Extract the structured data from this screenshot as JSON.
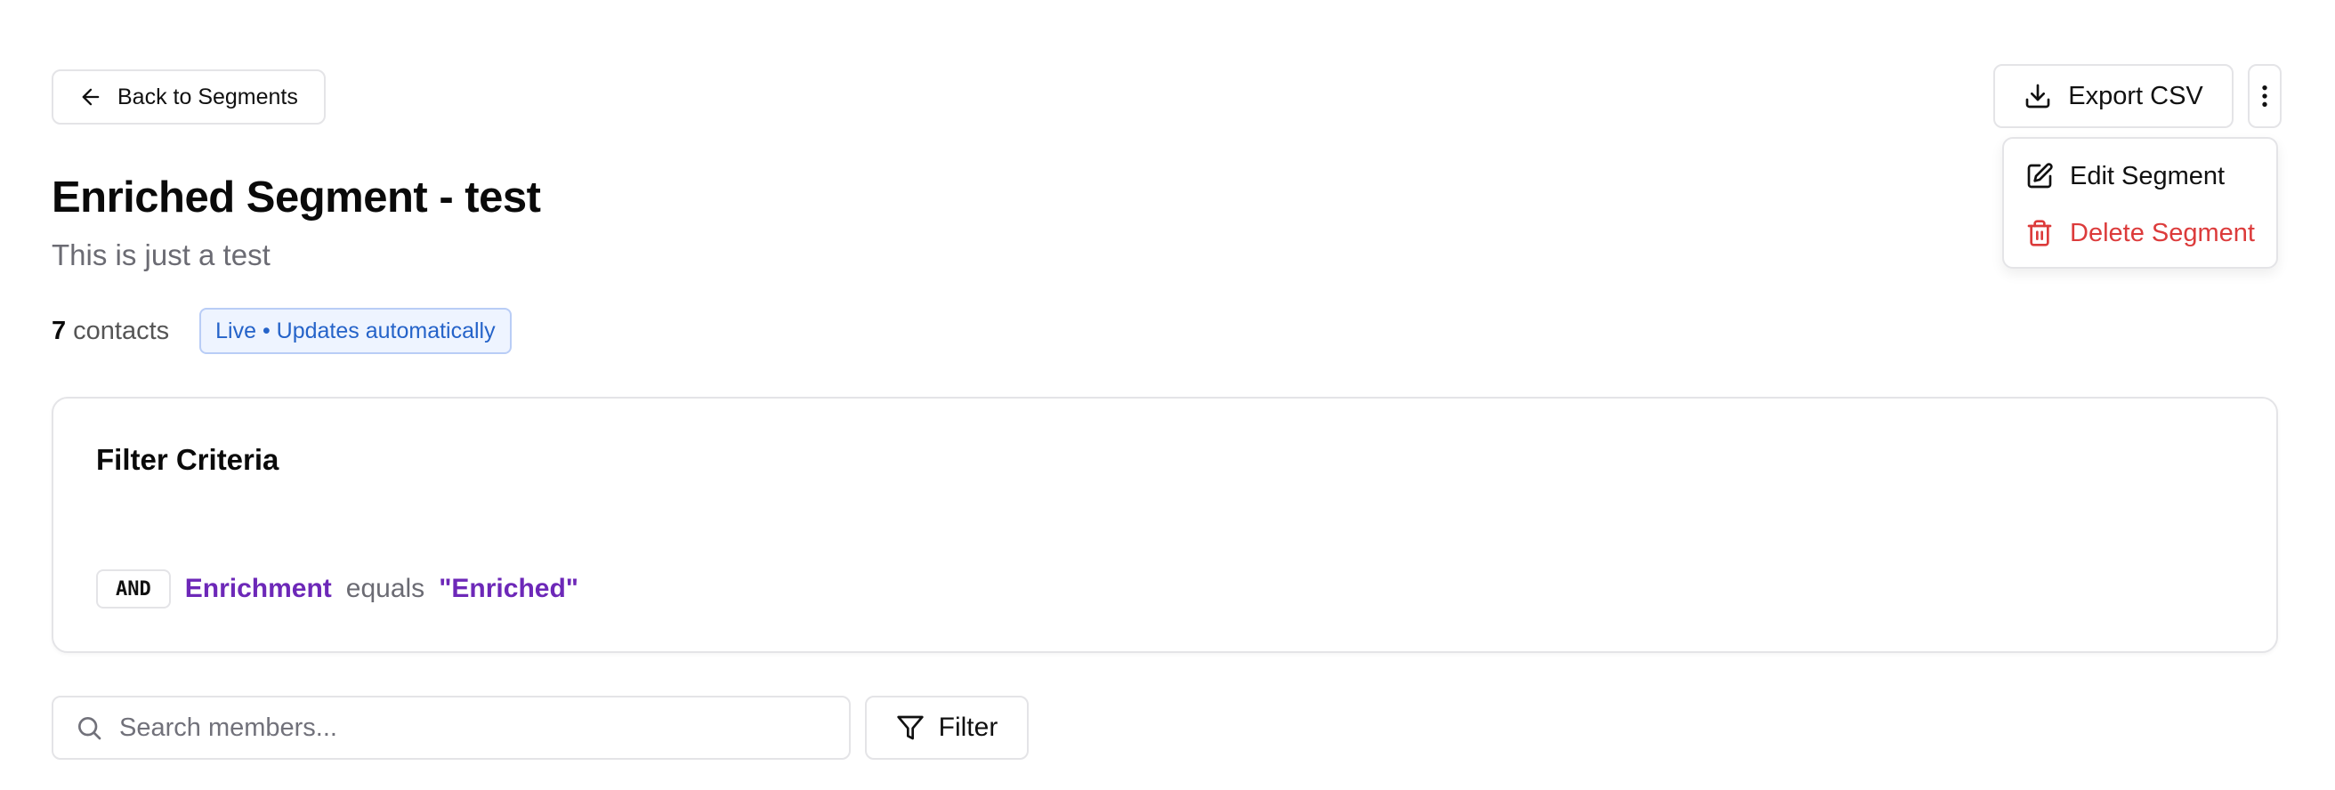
{
  "header": {
    "back_label": "Back to Segments",
    "export_label": "Export CSV",
    "more_icon": "more-vertical-icon"
  },
  "menu": {
    "edit_label": "Edit Segment",
    "delete_label": "Delete Segment",
    "delete_color": "#dc3b3b"
  },
  "segment": {
    "title": "Enriched Segment - test",
    "description": "This is just a test",
    "count": "7",
    "count_label": "contacts",
    "status_badge": "Live • Updates automatically",
    "badge_color": "#2563c9"
  },
  "filter_card": {
    "title": "Filter Criteria",
    "rules": [
      {
        "operator": "AND",
        "field": "Enrichment",
        "comparison": "equals",
        "value": "\"Enriched\""
      }
    ],
    "accent_color": "#6d28b8"
  },
  "toolbar": {
    "search_placeholder": "Search members...",
    "search_value": "",
    "filter_label": "Filter"
  }
}
